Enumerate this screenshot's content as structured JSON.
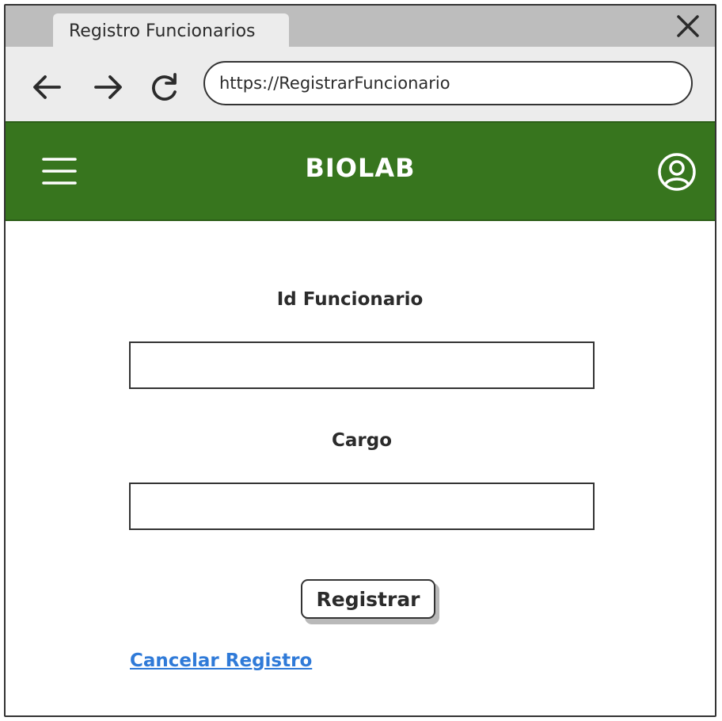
{
  "browser": {
    "tab_title": "Registro Funcionarios",
    "url": "https://RegistrarFuncionario",
    "icons": {
      "close": "close-icon",
      "back": "arrow-left-icon",
      "forward": "arrow-right-icon",
      "reload": "reload-icon"
    }
  },
  "app": {
    "brand": "BIOLAB",
    "header_color": "#37751e",
    "icons": {
      "menu": "hamburger-menu-icon",
      "profile": "user-profile-icon"
    }
  },
  "form": {
    "id_label": "Id Funcionario",
    "id_value": "",
    "cargo_label": "Cargo",
    "cargo_value": "",
    "submit_label": "Registrar",
    "cancel_label": "Cancelar Registro",
    "link_color": "#2f7ad8"
  }
}
